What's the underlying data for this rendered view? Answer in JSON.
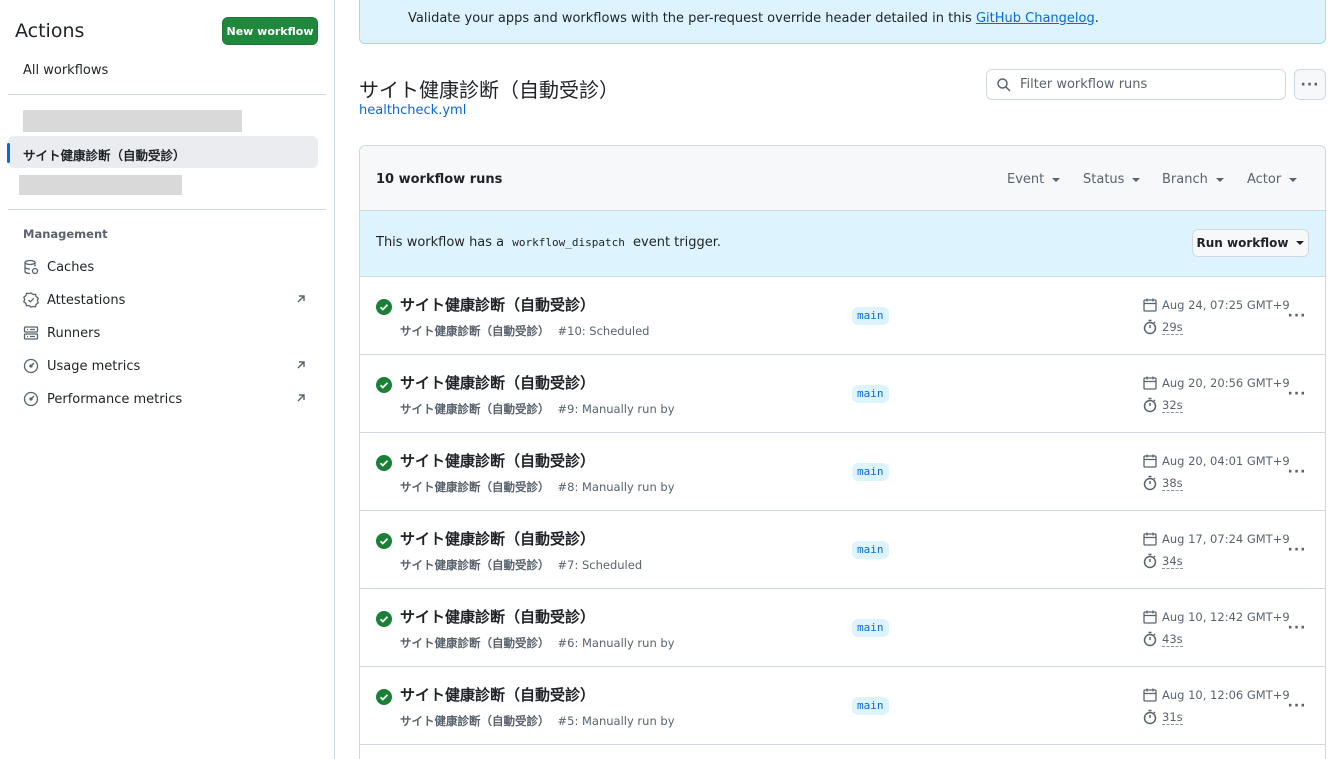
{
  "sidebar": {
    "title": "Actions",
    "new_workflow": "New workflow",
    "all_workflows": "All workflows",
    "active_workflow": "サイト健康診断（自動受診）",
    "management_heading": "Management",
    "items": [
      {
        "label": "Caches",
        "icon": "database-icon",
        "external": false
      },
      {
        "label": "Attestations",
        "icon": "verified-icon",
        "external": true
      },
      {
        "label": "Runners",
        "icon": "server-icon",
        "external": false
      },
      {
        "label": "Usage metrics",
        "icon": "meter-icon",
        "external": true
      },
      {
        "label": "Performance metrics",
        "icon": "meter-icon",
        "external": true
      }
    ]
  },
  "banner": {
    "text": "Validate your apps and workflows with the per-request override header detailed in this ",
    "link": "GitHub Changelog",
    "suffix": "."
  },
  "workflow": {
    "title": "サイト健康診断（自動受診）",
    "file": "healthcheck.yml"
  },
  "filter": {
    "placeholder": "Filter workflow runs",
    "value": ""
  },
  "runs": {
    "count_label": "10 workflow runs",
    "filters": [
      "Event",
      "Status",
      "Branch",
      "Actor"
    ],
    "dispatch_prefix": "This workflow has a",
    "dispatch_code": "workflow_dispatch",
    "dispatch_suffix": "event trigger.",
    "run_workflow_label": "Run workflow",
    "items": [
      {
        "title": "サイト健康診断（自動受診）",
        "workflow": "サイト健康診断（自動受診）",
        "detail": "#10: Scheduled",
        "branch": "main",
        "date": "Aug 24, 07:25 GMT+9",
        "duration": "29s",
        "status": "success"
      },
      {
        "title": "サイト健康診断（自動受診）",
        "workflow": "サイト健康診断（自動受診）",
        "detail": "#9: Manually run by",
        "branch": "main",
        "date": "Aug 20, 20:56 GMT+9",
        "duration": "32s",
        "status": "success"
      },
      {
        "title": "サイト健康診断（自動受診）",
        "workflow": "サイト健康診断（自動受診）",
        "detail": "#8: Manually run by",
        "branch": "main",
        "date": "Aug 20, 04:01 GMT+9",
        "duration": "38s",
        "status": "success"
      },
      {
        "title": "サイト健康診断（自動受診）",
        "workflow": "サイト健康診断（自動受診）",
        "detail": "#7: Scheduled",
        "branch": "main",
        "date": "Aug 17, 07:24 GMT+9",
        "duration": "34s",
        "status": "success"
      },
      {
        "title": "サイト健康診断（自動受診）",
        "workflow": "サイト健康診断（自動受診）",
        "detail": "#6: Manually run by",
        "branch": "main",
        "date": "Aug 10, 12:42 GMT+9",
        "duration": "43s",
        "status": "success"
      },
      {
        "title": "サイト健康診断（自動受診）",
        "workflow": "サイト健康診断（自動受診）",
        "detail": "#5: Manually run by",
        "branch": "main",
        "date": "Aug 10, 12:06 GMT+9",
        "duration": "31s",
        "status": "success"
      }
    ]
  },
  "colors": {
    "success": "#1a7f37",
    "accent": "#0969da",
    "primary_button": "#1f883d"
  }
}
